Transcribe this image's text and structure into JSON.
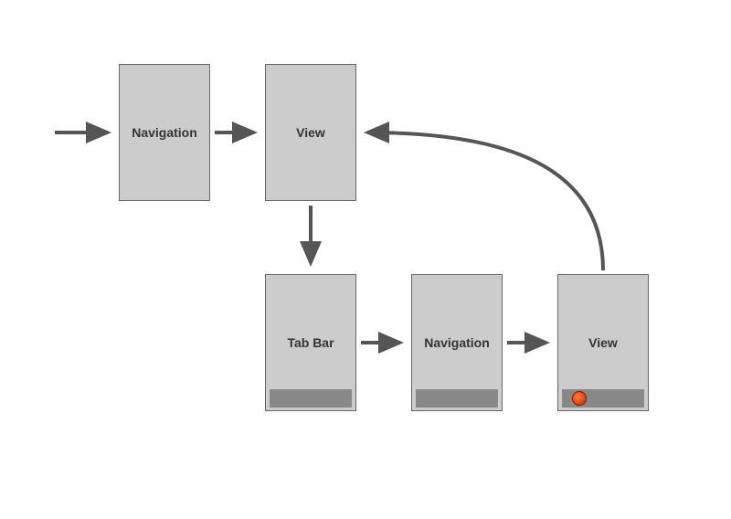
{
  "nodes": {
    "nav1": {
      "label": "Navigation"
    },
    "view1": {
      "label": "View"
    },
    "tabbar": {
      "label": "Tab Bar"
    },
    "nav2": {
      "label": "Navigation"
    },
    "view2": {
      "label": "View"
    }
  },
  "layout_note": "iOS-style view controller hierarchy diagram: Navigation → View, View pushes a Tab Bar container, Tab Bar contains Navigation → View, final View loops back up to first View.",
  "colors": {
    "node_fill": "#cccccc",
    "node_border": "#666666",
    "tab_strip": "#888888",
    "arrow": "#555555",
    "dot": "#e03a00"
  }
}
